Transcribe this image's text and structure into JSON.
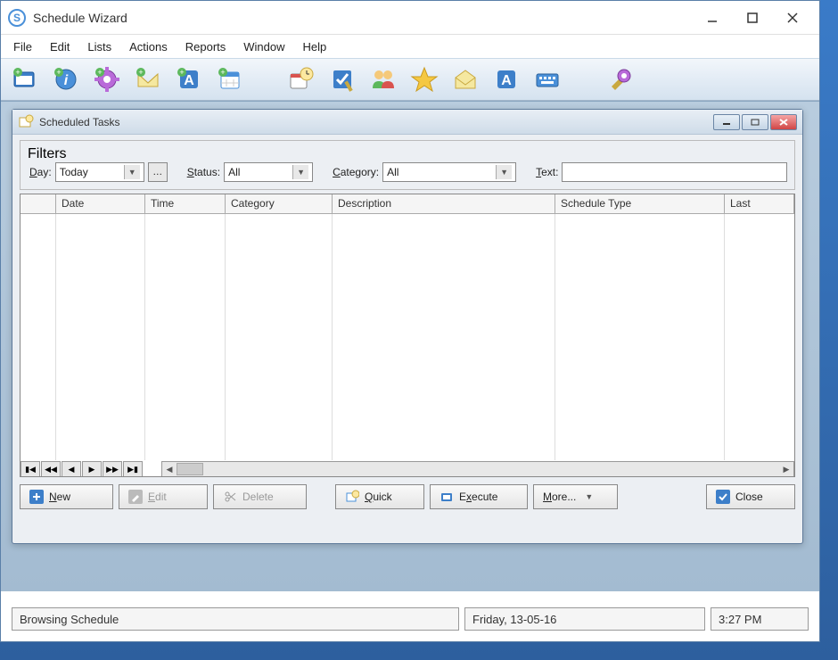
{
  "app": {
    "title": "Schedule Wizard"
  },
  "menu": {
    "file": "File",
    "edit": "Edit",
    "lists": "Lists",
    "actions": "Actions",
    "reports": "Reports",
    "window": "Window",
    "help": "Help"
  },
  "inner": {
    "title": "Scheduled Tasks"
  },
  "filters": {
    "legend": "Filters",
    "day_label": "Day:",
    "day_value": "Today",
    "status_label": "Status:",
    "status_value": "All",
    "category_label": "Category:",
    "category_value": "All",
    "text_label": "Text:",
    "text_value": ""
  },
  "columns": {
    "c0": "",
    "date": "Date",
    "time": "Time",
    "category": "Category",
    "description": "Description",
    "schedule_type": "Schedule Type",
    "last": "Last"
  },
  "buttons": {
    "new": "New",
    "edit": "Edit",
    "delete": "Delete",
    "quick": "Quick",
    "execute": "Execute",
    "more": "More...",
    "close": "Close"
  },
  "status": {
    "left": "Browsing Schedule",
    "mid": "Friday, 13-05-16",
    "right": "3:27 PM"
  }
}
